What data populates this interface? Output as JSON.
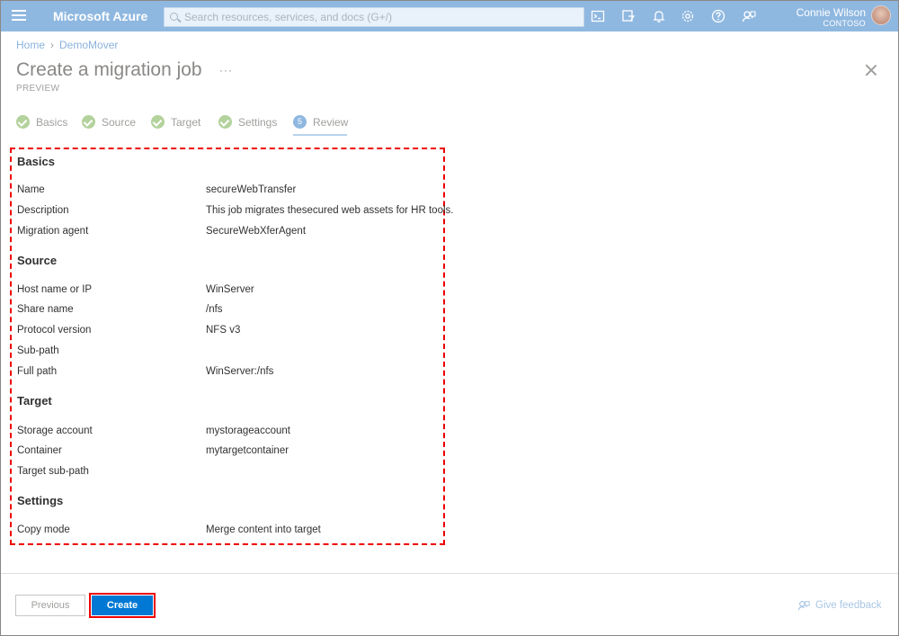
{
  "topbar": {
    "brand": "Microsoft Azure",
    "search_placeholder": "Search resources, services, and docs (G+/)",
    "user_name": "Connie Wilson",
    "user_org": "CONTOSO",
    "icons": [
      "cloud-shell-icon",
      "directory-filter-icon",
      "notifications-icon",
      "settings-icon",
      "help-icon",
      "feedback-icon"
    ]
  },
  "breadcrumb": {
    "home": "Home",
    "separator": "›",
    "current": "DemoMover"
  },
  "header": {
    "title": "Create a migration job",
    "more": "···",
    "subtitle": "PREVIEW"
  },
  "steps": [
    {
      "label": "Basics",
      "state": "complete"
    },
    {
      "label": "Source",
      "state": "complete"
    },
    {
      "label": "Target",
      "state": "complete"
    },
    {
      "label": "Settings",
      "state": "complete"
    },
    {
      "label": "Review",
      "number": "5",
      "state": "active"
    }
  ],
  "review": {
    "basics": {
      "heading": "Basics",
      "rows": [
        {
          "key": "Name",
          "value": "secureWebTransfer"
        },
        {
          "key": "Description",
          "value": "This job migrates thesecured web assets for HR tools."
        },
        {
          "key": "Migration agent",
          "value": "SecureWebXferAgent"
        }
      ]
    },
    "source": {
      "heading": "Source",
      "rows": [
        {
          "key": "Host name or IP",
          "value": "WinServer"
        },
        {
          "key": "Share name",
          "value": "/nfs"
        },
        {
          "key": "Protocol version",
          "value": "NFS v3"
        },
        {
          "key": "Sub-path",
          "value": ""
        },
        {
          "key": "Full path",
          "value": "WinServer:/nfs"
        }
      ]
    },
    "target": {
      "heading": "Target",
      "rows": [
        {
          "key": "Storage account",
          "value": "mystorageaccount"
        },
        {
          "key": "Container",
          "value": "mytargetcontainer"
        },
        {
          "key": "Target sub-path",
          "value": ""
        }
      ]
    },
    "settings": {
      "heading": "Settings",
      "rows": [
        {
          "key": "Copy mode",
          "value": "Merge content into target"
        }
      ]
    }
  },
  "footer": {
    "previous": "Previous",
    "create": "Create",
    "feedback": "Give feedback"
  },
  "colors": {
    "topbar": "#8fb8e0",
    "primary": "#0078d4",
    "highlight": "#e00000",
    "step_complete": "#b3d29c"
  }
}
